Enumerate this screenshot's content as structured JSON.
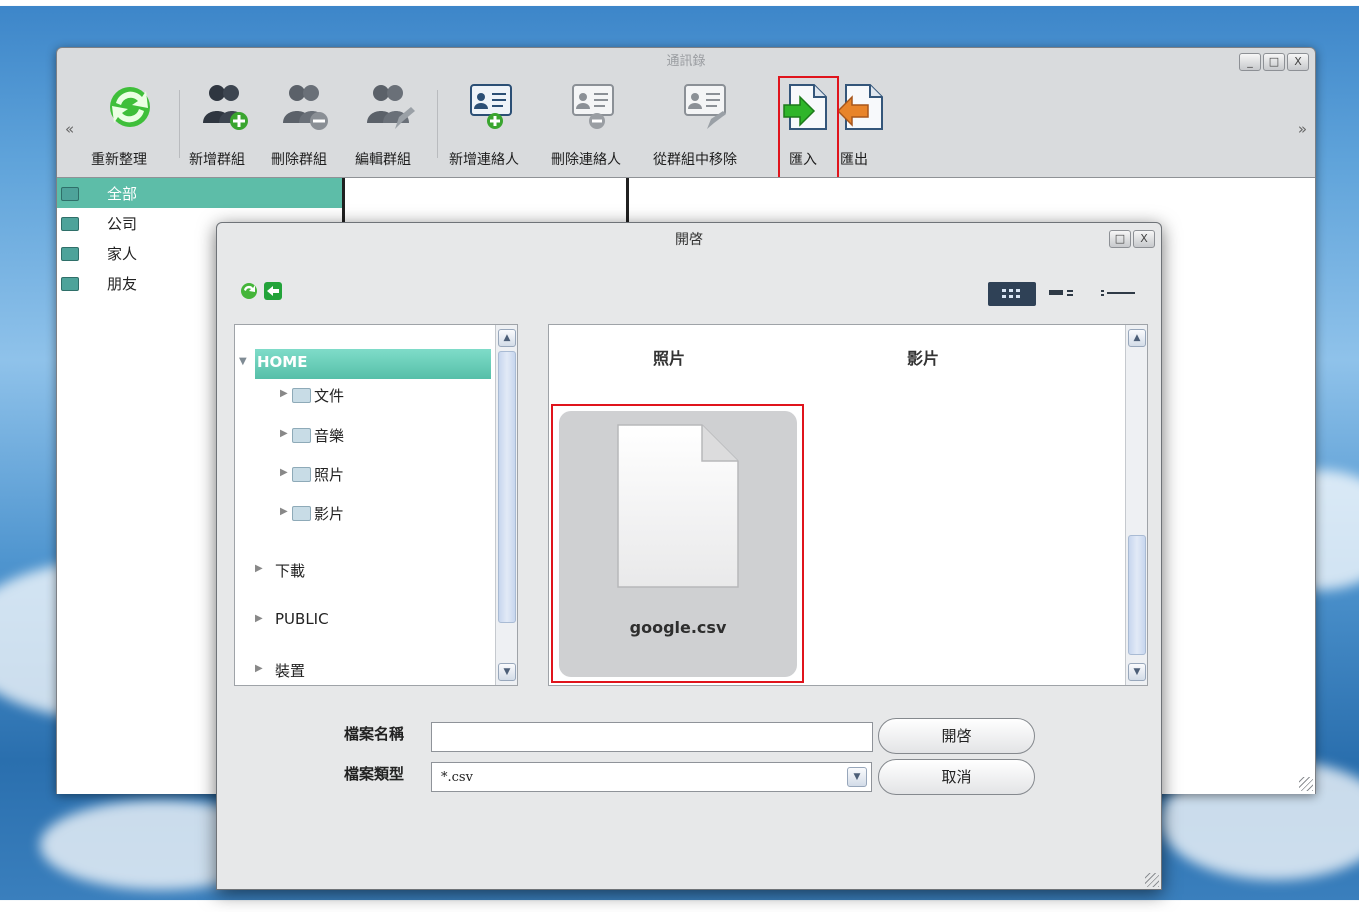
{
  "main_window": {
    "title": "通訊錄",
    "controls": {
      "minimize": "_",
      "maximize": "□",
      "close": "X"
    },
    "toolbar": {
      "scroll_left": "«",
      "scroll_right": "»",
      "buttons": [
        {
          "label": "重新整理",
          "icon": "refresh-icon"
        },
        {
          "label": "新增群組",
          "icon": "add-group-icon"
        },
        {
          "label": "刪除群組",
          "icon": "delete-group-icon"
        },
        {
          "label": "編輯群組",
          "icon": "edit-group-icon"
        },
        {
          "label": "新增連絡人",
          "icon": "add-contact-icon"
        },
        {
          "label": "刪除連絡人",
          "icon": "delete-contact-icon"
        },
        {
          "label": "從群組中移除",
          "icon": "remove-from-group-icon"
        },
        {
          "label": "匯入",
          "icon": "import-icon"
        },
        {
          "label": "匯出",
          "icon": "export-icon"
        }
      ]
    },
    "groups": [
      {
        "label": "全部",
        "selected": true
      },
      {
        "label": "公司"
      },
      {
        "label": "家人"
      },
      {
        "label": "朋友"
      }
    ]
  },
  "dialog": {
    "title": "開啓",
    "controls": {
      "maximize": "□",
      "close": "X"
    },
    "tools": {
      "refresh": "refresh-icon",
      "back": "back-icon"
    },
    "view_modes": [
      "icon-view-icon",
      "detail-view-icon",
      "list-view-icon"
    ],
    "tree": {
      "home": "HOME",
      "home_children": [
        "文件",
        "音樂",
        "照片",
        "影片"
      ],
      "roots": [
        "下載",
        "PUBLIC",
        "裝置"
      ]
    },
    "files": {
      "folders": [
        "照片",
        "影片"
      ],
      "selected_file": "google.csv"
    },
    "form": {
      "filename_label": "檔案名稱",
      "filename_value": "",
      "filetype_label": "檔案類型",
      "filetype_value": "*.csv",
      "open_button": "開啓",
      "cancel_button": "取消"
    },
    "colors": {
      "selection": "#5dbda8",
      "highlight": "#e0141c"
    }
  }
}
